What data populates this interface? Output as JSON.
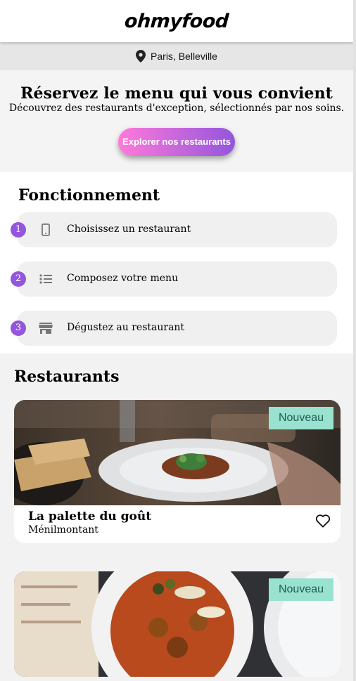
{
  "header": {
    "logo": "ohmyfood"
  },
  "location": {
    "icon": "map-pin-icon",
    "text": "Paris, Belleville"
  },
  "hero": {
    "title": "Réservez le menu qui vous convient",
    "subtitle": "Découvrez des restaurants d'exception, sélectionnés par nos soins.",
    "cta": "Explorer nos restaurants",
    "cta_gradient": [
      "#ff79da",
      "#9356dc"
    ]
  },
  "how": {
    "title": "Fonctionnement",
    "steps": [
      {
        "number": "1",
        "icon": "smartphone-icon",
        "label": "Choisissez un restaurant"
      },
      {
        "number": "2",
        "icon": "list-icon",
        "label": "Composez votre menu"
      },
      {
        "number": "3",
        "icon": "store-icon",
        "label": "Dégustez au restaurant"
      }
    ]
  },
  "restaurants": {
    "title": "Restaurants",
    "items": [
      {
        "badge": "Nouveau",
        "name": "La palette du goût",
        "area": "Ménilmontant",
        "favorite_icon": "heart-icon"
      },
      {
        "badge": "Nouveau",
        "name": "",
        "area": "",
        "favorite_icon": "heart-icon"
      }
    ]
  },
  "colors": {
    "accent": "#9356dc",
    "badge_bg": "#99e2d0",
    "badge_text": "#1f5c52"
  }
}
